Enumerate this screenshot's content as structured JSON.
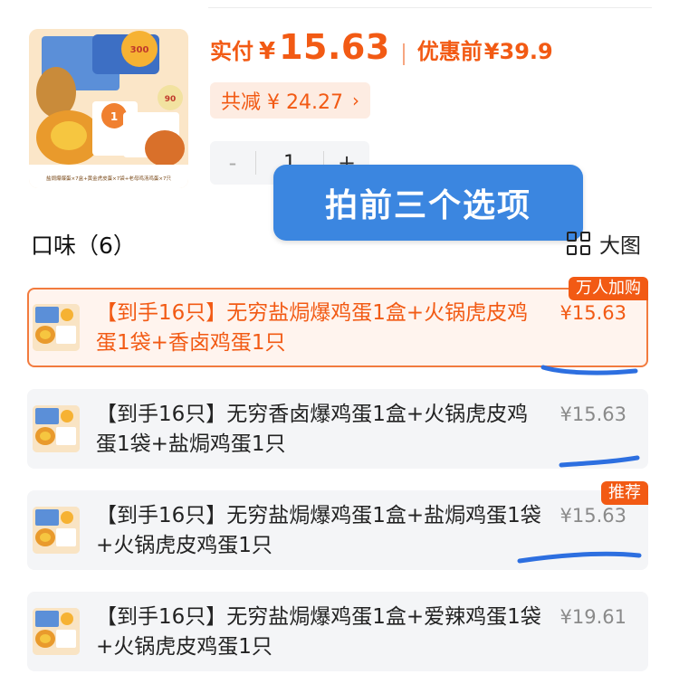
{
  "price": {
    "actual_label": "实付",
    "currency": "¥",
    "value": "15.63",
    "original_label": "优惠前",
    "original": "¥39.9",
    "discount_text": "共减 ¥ 24.27",
    "discount_chevron": "›"
  },
  "quantity": {
    "minus": "-",
    "value": "1",
    "plus": "+"
  },
  "overlay_text": "拍前三个选项",
  "flavor": {
    "title": "口味（6）",
    "bigview_label": "大图"
  },
  "product_image_text": {
    "badge_top": "300",
    "badge_mid": "1",
    "badge_right": "90",
    "bottom_strip": "盐焗爆爆蛋×7盒+黄金虎皮蛋×7袋+老母鸡汤鸡蛋×7只"
  },
  "options": [
    {
      "title": "【到手16只】无穷盐焗爆鸡蛋1盒+火锅虎皮鸡蛋1袋+香卤鸡蛋1只",
      "price": "¥15.63",
      "tag": "万人加购",
      "selected": true
    },
    {
      "title": "【到手16只】无穷香卤爆鸡蛋1盒+火锅虎皮鸡蛋1袋+盐焗鸡蛋1只",
      "price": "¥15.63",
      "tag": "",
      "selected": false
    },
    {
      "title": "【到手16只】无穷盐焗爆鸡蛋1盒+盐焗鸡蛋1袋+火锅虎皮鸡蛋1只",
      "price": "¥15.63",
      "tag": "推荐",
      "selected": false
    },
    {
      "title": "【到手16只】无穷盐焗爆鸡蛋1盒+爱辣鸡蛋1袋+火锅虎皮鸡蛋1只",
      "price": "¥19.61",
      "tag": "",
      "selected": false
    }
  ],
  "colors": {
    "accent": "#f25a14",
    "overlay_blue": "#3b86e0",
    "scribble_blue": "#2d6fe0"
  }
}
